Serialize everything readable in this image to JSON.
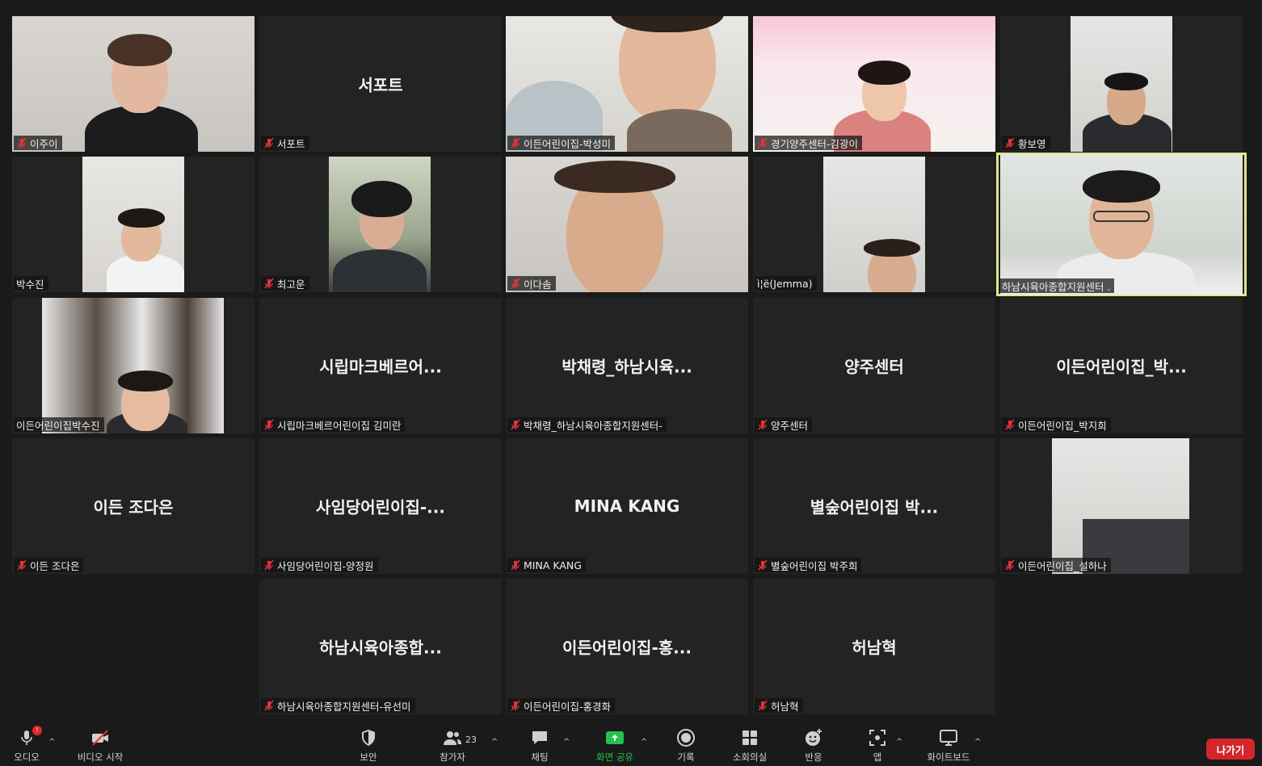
{
  "participants": [
    {
      "name": "이주이"
    },
    {
      "name": "서포트",
      "display": "서포트"
    },
    {
      "name": "이든어린이집-박성미"
    },
    {
      "name": "경기양주센터-김광이"
    },
    {
      "name": "황보영"
    },
    {
      "name": "박수진"
    },
    {
      "name": "최고운"
    },
    {
      "name": "이다솜"
    },
    {
      "name": "ì¦ë(Jemma)"
    },
    {
      "name": "하남시육아종합지원센터 ."
    },
    {
      "name": "이든어린이집박수진"
    },
    {
      "name": "시립마크베르어린이집 김미란",
      "display": "시립마크베르어..."
    },
    {
      "name": "박채령_하남시육아종합지원센터-",
      "display": "박채령_하남시육..."
    },
    {
      "name": "양주센터",
      "display": "양주센터"
    },
    {
      "name": "이든어린이집_박지희",
      "display": "이든어린이집_박..."
    },
    {
      "name": "이든 조다은",
      "display": "이든 조다은"
    },
    {
      "name": "사임당어린이집-양정원",
      "display": "사임당어린이집-..."
    },
    {
      "name": "MINA KANG",
      "display": "MINA KANG"
    },
    {
      "name": "별숲어린이집 박주희",
      "display": "별숲어린이집 박..."
    },
    {
      "name": "이든어린이집_설하나"
    },
    {
      "name": "하남시육아종합지원센터-유선미",
      "display": "하남시육아종합..."
    },
    {
      "name": "이든어린이집-홍경화",
      "display": "이든어린이집-홍..."
    },
    {
      "name": "허남혁",
      "display": "허남혁"
    }
  ],
  "toolbar": {
    "audio": "오디오",
    "audio_badge": "!",
    "video": "비디오 시작",
    "security": "보안",
    "participants": "참가자",
    "participants_count": "23",
    "chat": "채팅",
    "share": "화면 공유",
    "record": "기록",
    "breakout": "소회의실",
    "reactions": "반응",
    "apps": "앱",
    "whiteboard": "화이트보드",
    "leave": "나가기"
  },
  "colors": {
    "active_speaker_border": "#e3e78a",
    "share_green": "#26c250",
    "leave_red": "#d3262a",
    "mute_red": "#e0333a"
  }
}
